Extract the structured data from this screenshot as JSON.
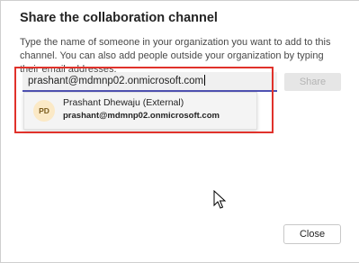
{
  "dialog": {
    "title": "Share the collaboration channel",
    "description": "Type the name of someone in your organization you want to add to this channel. You can also add people outside your organization by typing their email addresses."
  },
  "search": {
    "value": "prashant@mdmnp02.onmicrosoft.com"
  },
  "share_label": "Share",
  "suggestion": {
    "initials": "PD",
    "name": "Prashant Dhewaju (External)",
    "email": "prashant@mdmnp02.onmicrosoft.com",
    "avatar_color": "#fbe9c6"
  },
  "close_label": "Close",
  "colors": {
    "accent": "#4f52b2",
    "highlight": "#e0322b"
  },
  "icons": {
    "cursor": "mouse-pointer-icon"
  }
}
